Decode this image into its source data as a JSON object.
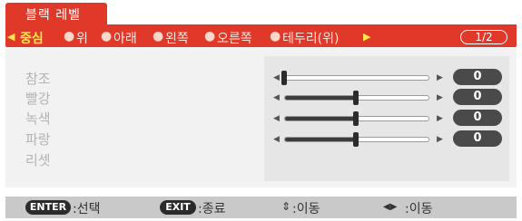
{
  "menu": {
    "title": "블랙 레벨",
    "tabs": [
      "중심",
      "위",
      "아래",
      "왼쪽",
      "오른쪽",
      "테두리(위)"
    ],
    "active_tab_index": 0,
    "page_indicator": "1/2",
    "colors": {
      "accent": "#e0392a",
      "active_tab": "#ffe84a"
    }
  },
  "rows": [
    {
      "label": "참조",
      "value": "0",
      "level_fraction": 0.0
    },
    {
      "label": "빨강",
      "value": "0",
      "level_fraction": 0.5
    },
    {
      "label": "녹색",
      "value": "0",
      "level_fraction": 0.5
    },
    {
      "label": "파랑",
      "value": "0",
      "level_fraction": 0.5
    },
    {
      "label": "리셋"
    }
  ],
  "footer": {
    "enter_key": "ENTER",
    "enter_hint": ":선택",
    "exit_key": "EXIT",
    "exit_hint": ":종료",
    "move_ud_hint": ":이동",
    "move_lr_hint": ":이동"
  }
}
